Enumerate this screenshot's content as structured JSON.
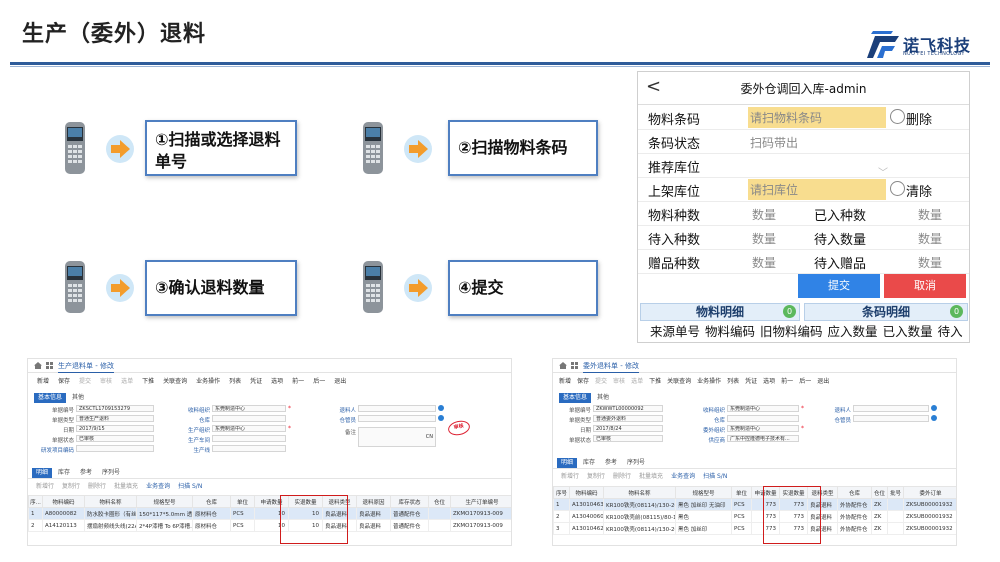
{
  "page": {
    "title": "生产（委外）退料"
  },
  "logo": {
    "name": "诺飞科技",
    "subtitle": "NUO FEI TECHNOLOGY"
  },
  "steps": [
    {
      "label": "①扫描或选择退料单号"
    },
    {
      "label": "②扫描物料条码"
    },
    {
      "label": "③确认退料数量"
    },
    {
      "label": "④提交"
    }
  ],
  "mobile": {
    "back_glyph": "<",
    "title": "委外仓调回入库-admin",
    "barcode_label": "物料条码",
    "barcode_placeholder": "请扫物料条码",
    "delete_label": "删除",
    "status_label": "条码状态",
    "status_value": "扫码带出",
    "recommend_label": "推荐库位",
    "shelf_label": "上架库位",
    "shelf_placeholder": "请扫库位",
    "clear_label": "清除",
    "stats": [
      {
        "left_label": "物料种数",
        "left_value": "数量",
        "right_label": "已入种数",
        "right_value": "数量"
      },
      {
        "left_label": "待入种数",
        "left_value": "数量",
        "right_label": "待入数量",
        "right_value": "数量"
      },
      {
        "left_label": "赠品种数",
        "left_value": "数量",
        "right_label": "待入赠品",
        "right_value": "数量"
      }
    ],
    "submit_label": "提交",
    "cancel_label": "取消",
    "tab_material": "物料明细",
    "tab_material_count": "0",
    "tab_barcode": "条码明细",
    "tab_barcode_count": "0",
    "columns": [
      "来源单号",
      "物料编码",
      "旧物料编码",
      "应入数量",
      "已入数量",
      "待入"
    ]
  },
  "erp_left": {
    "tab_title": "生产退料单 - 修改",
    "toolbar": [
      "新增",
      "保存",
      "提交",
      "审核",
      "选单",
      "下推",
      "关联查询",
      "业务操作",
      "列表",
      "凭证",
      "选项",
      "前一",
      "后一",
      "退出"
    ],
    "section_tabs": [
      "基本信息",
      "其他"
    ],
    "form": {
      "doc_no_label": "单据编号",
      "doc_no": "ZKSCTL1709153279",
      "doc_type_label": "单据类型",
      "doc_type": "普通生产退料",
      "date_label": "日期",
      "date": "2017/9/15",
      "status_label": "单据状态",
      "status": "已审核",
      "project_label": "研发项目编码",
      "org_label": "收料组织",
      "org": "东莞制造中心",
      "wh_label": "仓库",
      "prod_org_label": "生产组织",
      "prod_org": "东莞制造中心",
      "workshop_label": "生产车间",
      "line_label": "生产线",
      "returner_label": "退料人",
      "keeper_label": "仓管员",
      "remark_label": "备注",
      "remark": "CN",
      "stamp": "审核"
    },
    "sub_tabs": [
      "明细",
      "库存",
      "参考",
      "序列号"
    ],
    "sub_toolbar": [
      "新增行",
      "复制行",
      "删除行",
      "批量填充",
      "业务查询",
      "扫描 S/N"
    ],
    "table_headers": [
      "序...",
      "物料编码",
      "物料名称",
      "规格型号",
      "仓库",
      "单位",
      "申请数量",
      "实退数量",
      "退料类型",
      "退料原因",
      "库存状态",
      "仓位",
      "生产订单编号"
    ],
    "rows": [
      [
        "1",
        "A80000082",
        "防水胶卡圈形（有丝印）",
        "150*117*5.0mm 透...",
        "原材料仓",
        "PCS",
        "10",
        "10",
        "良品退料",
        "良品退料",
        "普通配件仓",
        "",
        "ZKMO170913-009"
      ],
      [
        "2",
        "A14120113",
        "摆扇射频线头线(22AWG)",
        "2*4P漆槽 To 6P漆槽...",
        "原材料仓",
        "PCS",
        "10",
        "10",
        "良品退料",
        "良品退料",
        "普通配件仓",
        "",
        "ZKMO170913-009"
      ]
    ]
  },
  "erp_right": {
    "tab_title": "委外退料单 - 修改",
    "toolbar": [
      "新增",
      "保存",
      "提交",
      "审核",
      "选单",
      "下推",
      "关联查询",
      "业务操作",
      "列表",
      "凭证",
      "选项",
      "前一",
      "后一",
      "退出"
    ],
    "section_tabs": [
      "基本信息",
      "其他"
    ],
    "form": {
      "doc_no_label": "单据编号",
      "doc_no": "ZKWWTL00000092",
      "doc_type_label": "单据类型",
      "doc_type": "普通委外退料",
      "date_label": "日期",
      "date": "2017/8/24",
      "status_label": "单据状态",
      "status": "已审核",
      "org_label": "收料组织",
      "org": "东莞制造中心",
      "wh_label": "仓库",
      "entrust_label": "委外组织",
      "entrust": "东莞制造中心",
      "supplier_label": "供应商",
      "supplier": "广东中控隆德电子技术有...",
      "returner_label": "退料人",
      "keeper_label": "仓管员"
    },
    "sub_tabs": [
      "明细",
      "库存",
      "参考",
      "序列号"
    ],
    "sub_toolbar": [
      "新增行",
      "复制行",
      "删除行",
      "批量填充",
      "业务查询",
      "扫描 S/N"
    ],
    "table_headers": [
      "序号",
      "物料编码",
      "物料名称",
      "规格型号",
      "单位",
      "申请数量",
      "实退数量",
      "退料类型",
      "仓库",
      "仓位",
      "批号",
      "委外订单"
    ],
    "rows": [
      [
        "1",
        "A13010463",
        "KR100铁壳(08114)/130-200T",
        "黑色 加丝印 无油印",
        "PCS",
        "773",
        "773",
        "良品退料",
        "外协配件仓",
        "ZK",
        "",
        "ZKSUB00001932"
      ],
      [
        "2",
        "A13040060",
        "KR100铁壳前(08115)/80-130T",
        "黑色",
        "PCS",
        "773",
        "773",
        "良品退料",
        "外协配件仓",
        "ZK",
        "",
        "ZKSUB00001932"
      ],
      [
        "3",
        "A13010462",
        "KR100铁壳(08114)/130-200T",
        "黑色 加丝印",
        "PCS",
        "773",
        "773",
        "良品退料",
        "外协配件仓",
        "ZK",
        "",
        "ZKSUB00001932"
      ]
    ]
  },
  "colors": {
    "accent": "#2e5c9a",
    "highlight": "#d01c1c",
    "input_yellow": "#f8dd8f",
    "submit": "#3083e6",
    "cancel": "#ea4a4a"
  }
}
